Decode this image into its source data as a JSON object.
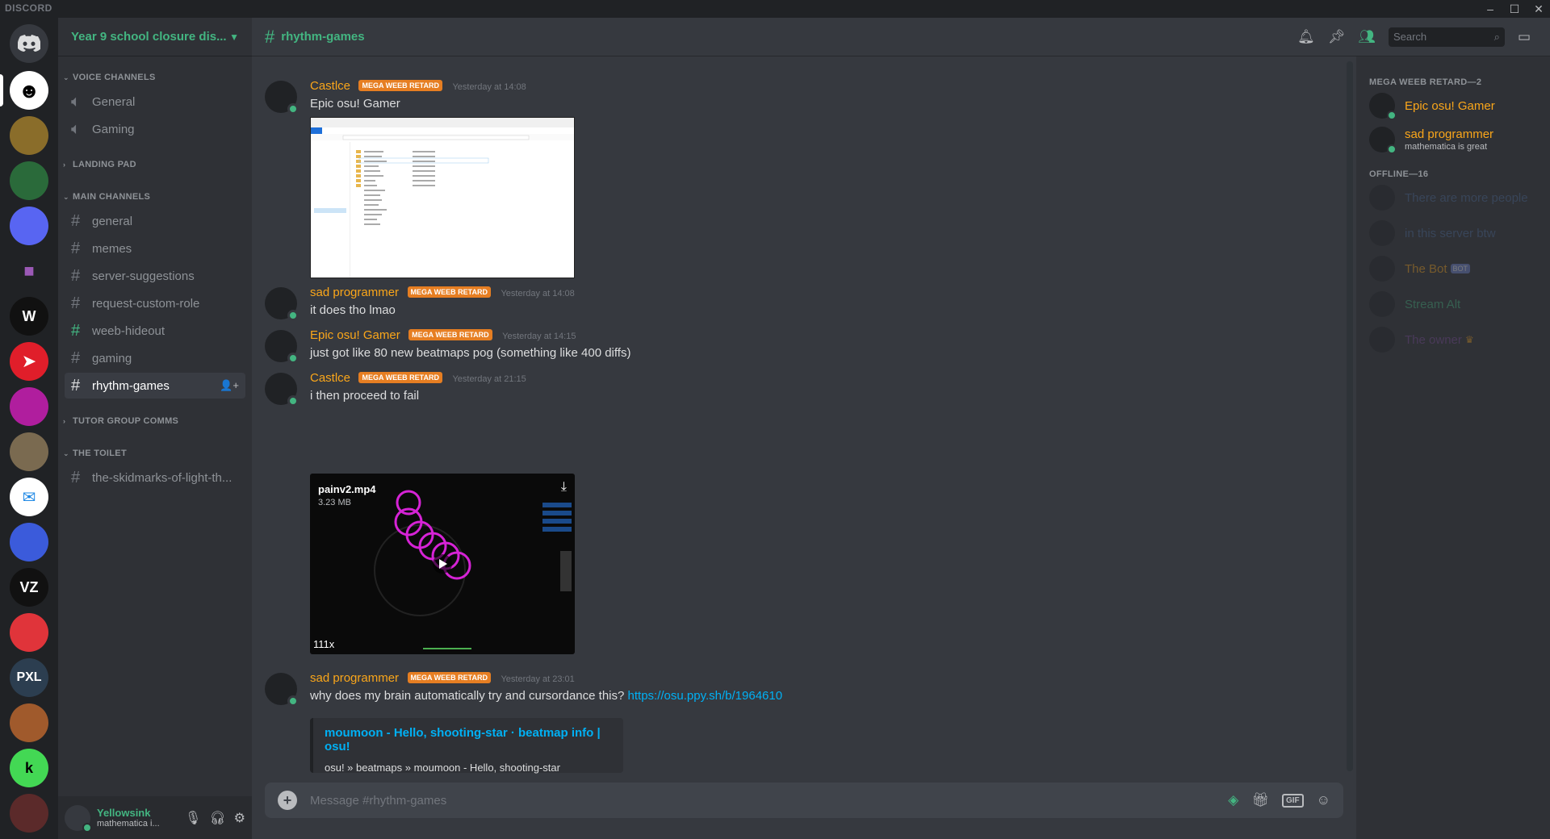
{
  "window": {
    "brand": "DISCORD"
  },
  "guild": {
    "name": "Year 9 school closure dis..."
  },
  "categories": {
    "voice": "VOICE CHANNELS",
    "landing": "LANDING PAD",
    "main": "MAIN CHANNELS",
    "tutor": "TUTOR GROUP COMMS",
    "toilet": "THE TOILET"
  },
  "voice_channels": [
    "General",
    "Gaming"
  ],
  "main_channels": [
    "general",
    "memes",
    "server-suggestions",
    "request-custom-role",
    "weeb-hideout",
    "gaming",
    "rhythm-games"
  ],
  "toilet_channels": [
    "the-skidmarks-of-light-th..."
  ],
  "server_labels": {
    "w": "W",
    "vz": "VZ",
    "pxl": "PXL"
  },
  "user": {
    "name": "Yellowsink",
    "status": "mathematica i..."
  },
  "channel": {
    "name": "rhythm-games",
    "search_placeholder": "Search",
    "composer_placeholder": "Message #rhythm-games"
  },
  "role_tag": "MEGA WEEB RETARD",
  "messages": [
    {
      "author": "Castlce",
      "time": "Yesterday at 14:08",
      "text": "Epic osu! Gamer"
    },
    {
      "author": "sad programmer",
      "time": "Yesterday at 14:08",
      "text": "it does tho lmao"
    },
    {
      "author": "Epic osu! Gamer",
      "time": "Yesterday at 14:15",
      "text": "just got like 80 new beatmaps pog  (something like 400 diffs)"
    },
    {
      "author": "Castlce",
      "time": "Yesterday at 21:15",
      "text": "i then proceed to fail"
    },
    {
      "author": "sad programmer",
      "time": "Yesterday at 23:01",
      "text": "why does my brain automatically try and cursordance this?",
      "link": "https://osu.ppy.sh/b/1964610"
    }
  ],
  "video": {
    "filename": "painv2.mp4",
    "size": "3.23 MB",
    "combo": "111x"
  },
  "link_embed": {
    "title": "moumoon - Hello, shooting-star · beatmap info | osu!",
    "description": "osu! » beatmaps » moumoon - Hello, shooting-star"
  },
  "members": {
    "online_header": "MEGA WEEB RETARD—2",
    "online": [
      {
        "name": "Epic osu! Gamer",
        "status": ""
      },
      {
        "name": "sad programmer",
        "status": "mathematica is great"
      }
    ],
    "offline_header": "OFFLINE—16",
    "offline": [
      {
        "name": "There are more people"
      },
      {
        "name": "in this server btw"
      },
      {
        "name": "The Bot",
        "tag": "BOT"
      },
      {
        "name": "Stream Alt"
      },
      {
        "name": "The owner"
      }
    ]
  },
  "icons": {
    "bell": "bell-icon",
    "pin": "pin-icon",
    "members": "members-icon",
    "inbox": "inbox-icon",
    "mic": "microphone-icon",
    "headphones": "headphones-icon",
    "settings": "gear-icon",
    "gift": "gift-icon",
    "emoji": "emoji-icon"
  },
  "colors": {
    "online_green": "#43b581",
    "name_orange": "#faa61a",
    "role_tag": "#e67e22",
    "link": "#00b0f4"
  }
}
